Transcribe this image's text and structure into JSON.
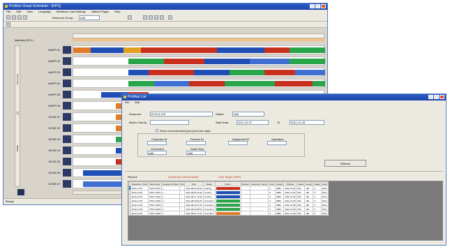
{
  "back_window": {
    "title": "ProMan Visual Scheduler - [RPS]",
    "menu": [
      "File",
      "Edit",
      "View",
      "Language",
      "Workflow Load Settings",
      "Tabbed Pages",
      "Help"
    ],
    "toolbar_label": "Resource Group:",
    "toolbar_select": "(All)",
    "left_header": "Machine (R.S.)",
    "group_labels": [
      "Print Group",
      "Saddle"
    ],
    "resources": [
      {
        "label": "HeiPP 01",
        "thumb": "dark",
        "segments": [
          {
            "from": 0.0,
            "to": 0.07,
            "color": "#e07b2a"
          },
          {
            "from": 0.07,
            "to": 0.2,
            "color": "#1f4fb5"
          },
          {
            "from": 0.2,
            "to": 0.27,
            "color": "#e0a020"
          },
          {
            "from": 0.27,
            "to": 0.57,
            "color": "#c8301e"
          },
          {
            "from": 0.57,
            "to": 0.76,
            "color": "#1f4fb5"
          },
          {
            "from": 0.76,
            "to": 0.86,
            "color": "#c8301e"
          },
          {
            "from": 0.86,
            "to": 1.0,
            "color": "#2aa64a"
          }
        ]
      },
      {
        "label": "HeiPP 02",
        "thumb": "dark",
        "segments": [
          {
            "from": 0.22,
            "to": 0.36,
            "color": "#2aa64a"
          },
          {
            "from": 0.36,
            "to": 0.52,
            "color": "#c8301e"
          },
          {
            "from": 0.52,
            "to": 0.7,
            "color": "#1f4fb5"
          },
          {
            "from": 0.7,
            "to": 0.86,
            "color": "#3f6fd1"
          },
          {
            "from": 0.86,
            "to": 1.0,
            "color": "#2aa64a"
          }
        ]
      },
      {
        "label": "HeiPP 03",
        "thumb": "dark",
        "segments": [
          {
            "from": 0.22,
            "to": 0.3,
            "color": "#1f4fb5"
          },
          {
            "from": 0.3,
            "to": 0.48,
            "color": "#c8301e"
          },
          {
            "from": 0.48,
            "to": 0.62,
            "color": "#1f4fb5"
          },
          {
            "from": 0.62,
            "to": 0.76,
            "color": "#2aa64a"
          },
          {
            "from": 0.76,
            "to": 0.88,
            "color": "#c8301e"
          },
          {
            "from": 0.88,
            "to": 1.0,
            "color": "#3f6fd1"
          }
        ]
      },
      {
        "label": "HeiPP 04",
        "thumb": "dark",
        "segments": [
          {
            "from": 0.22,
            "to": 0.32,
            "color": "#2aa64a"
          },
          {
            "from": 0.32,
            "to": 0.46,
            "color": "#3f6fd1"
          },
          {
            "from": 0.46,
            "to": 0.6,
            "color": "#c8301e"
          },
          {
            "from": 0.6,
            "to": 0.8,
            "color": "#2aa64a"
          },
          {
            "from": 0.8,
            "to": 0.95,
            "color": "#c8301e"
          },
          {
            "from": 0.95,
            "to": 1.0,
            "color": "#2aa64a"
          }
        ]
      },
      {
        "label": "HeiPP 05",
        "thumb": "dark",
        "segments": [
          {
            "from": 0.11,
            "to": 0.22,
            "color": "#1f4fb5"
          },
          {
            "from": 0.22,
            "to": 0.3,
            "color": "#c8301e"
          }
        ]
      },
      {
        "label": "HeiPP 06",
        "thumb": "dark",
        "segments": [
          {
            "from": 0.17,
            "to": 0.22,
            "color": "#e07b2a"
          }
        ]
      },
      {
        "label": "SCHE 01",
        "thumb": "dark",
        "segments": [
          {
            "from": 0.17,
            "to": 0.22,
            "color": "#e07b2a"
          }
        ]
      },
      {
        "label": "SCHE 02",
        "thumb": "dark",
        "segments": [
          {
            "from": 0.17,
            "to": 0.22,
            "color": "#e07b2a"
          }
        ]
      },
      {
        "label": "SCHE 03",
        "thumb": "dark",
        "segments": [
          {
            "from": 0.17,
            "to": 0.22,
            "color": "#2aa64a"
          }
        ]
      },
      {
        "label": "SCHE 04",
        "thumb": "dark",
        "segments": [
          {
            "from": 0.17,
            "to": 0.22,
            "color": "#1f4fb5"
          }
        ]
      },
      {
        "label": "SCHE 05",
        "thumb": "dark",
        "segments": [
          {
            "from": 0.17,
            "to": 0.22,
            "color": "#c8301e"
          }
        ]
      },
      {
        "label": "SCHE 06",
        "thumb": "dark",
        "segments": [
          {
            "from": 0.04,
            "to": 0.2,
            "color": "#1f4fb5"
          }
        ]
      },
      {
        "label": "SCHE 07",
        "thumb": "dark",
        "segments": [
          {
            "from": 0.04,
            "to": 0.2,
            "color": "#3f6fd1"
          }
        ]
      }
    ],
    "status": "Ready"
  },
  "front_window": {
    "title": "ProMan List",
    "menu": [
      "File",
      "Edit"
    ],
    "form": {
      "resource_label": "Resource:",
      "resource_value": "ECS-A-375",
      "status_label": "Status:",
      "status_value": "(All)",
      "search_label": "Match Criteria:",
      "start_label": "Start Date:",
      "start_value": "2011-12-07",
      "to_label": "To:",
      "to_value": "2011-12-26",
      "checkbox_label": "Show unit-scheduled jobs (Info/Job data)",
      "fields": [
        "Customer ID",
        "Product ID",
        "Equipment ID",
        "Operation",
        "Exceeded",
        "Sheet Size"
      ],
      "field_values": [
        "(All)",
        "(All)"
      ],
      "refresh_label": "Refresh"
    },
    "legend": {
      "label": "Record:",
      "scheduled": "Scheduled   Unscheduled",
      "overdue": "Over target (OPS)"
    },
    "table": {
      "headers": [
        "",
        "Operation / Prod",
        "Work order",
        "Program ID Qual",
        "Job",
        "Due",
        "Status",
        "Colour",
        "Product",
        "Customer / Descr",
        "Units",
        "Length",
        "Ordered",
        "Labels",
        "Length",
        "Target",
        "Start"
      ],
      "rows": [
        {
          "id": "ECS-A-375",
          "wo": "75517-0001",
          "q": "1",
          "due": "2011-08-25 06:06",
          "status": "Starting",
          "color": "#c8301e",
          "units": "4",
          "len": "9880",
          "ord": "2011-07-04",
          "lab": "960",
          "len2": "160",
          "tgt": "5",
          "start": "2011-"
        },
        {
          "id": "ECS-A-375",
          "wo": "75517-0001",
          "q": "2",
          "due": "2011-08-26 11:06",
          "status": "Confirm",
          "color": "#1f4fb5",
          "units": "4",
          "len": "9880",
          "ord": "2011-07-04",
          "lab": "960",
          "len2": "160",
          "tgt": "5",
          "start": "2011-"
        },
        {
          "id": "ECS-A-375",
          "wo": "75517-0002",
          "q": "1",
          "due": "2011-08-27 12:54",
          "status": "Confirm",
          "color": "#1f4fb5",
          "units": "4",
          "len": "9880",
          "ord": "2011-07-05",
          "lab": "960",
          "len2": "160",
          "tgt": "5",
          "start": "2011-"
        },
        {
          "id": "ECS-A-375",
          "wo": "75517-0002",
          "q": "2",
          "due": "2011-08-28 09:15",
          "status": "Unconfirm",
          "color": "#2aa64a",
          "units": "4",
          "len": "9880",
          "ord": "2011-07-05",
          "lab": "960",
          "len2": "160",
          "tgt": "5",
          "start": "2011-"
        },
        {
          "id": "ECS-A-376",
          "wo": "75517-0003",
          "q": "1",
          "due": "2011-08-29 17:32",
          "status": "Unconfirm",
          "color": "#2aa64a",
          "units": "4",
          "len": "9880",
          "ord": "2011-07-05",
          "lab": "960",
          "len2": "160",
          "tgt": "5",
          "start": "2011-"
        },
        {
          "id": "ECS-A-376",
          "wo": "75517-0003",
          "q": "2",
          "due": "2011-08-30 08:24",
          "status": "Unconfirm",
          "color": "#2aa64a",
          "units": "4",
          "len": "9880",
          "ord": "2011-07-06",
          "lab": "960",
          "len2": "160",
          "tgt": "5",
          "start": "2011-"
        },
        {
          "id": "ECS-A-376",
          "wo": "75517-0004",
          "q": "1",
          "due": "2011-08-31 12:11",
          "status": "Unconfirm",
          "color": "#e07b2a",
          "units": "4",
          "len": "9880",
          "ord": "2011-07-06",
          "lab": "960",
          "len2": "160",
          "tgt": "5",
          "start": "2011-"
        }
      ]
    }
  }
}
